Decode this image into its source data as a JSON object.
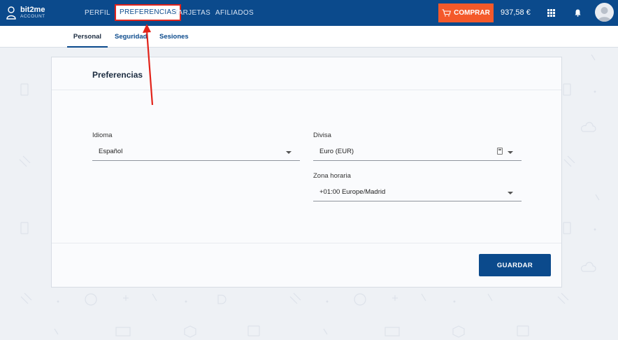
{
  "brand": {
    "name": "bit2me",
    "subtitle": "ACCOUNT"
  },
  "topnav": {
    "items": [
      {
        "label": "PERFIL"
      },
      {
        "label": "PREFERENCIAS"
      },
      {
        "label": "TARJETAS"
      },
      {
        "label": "AFILIADOS"
      }
    ],
    "buy_label": "COMPRAR",
    "balance": "937,58 €"
  },
  "subnav": {
    "tabs": [
      {
        "label": "Personal"
      },
      {
        "label": "Seguridad"
      },
      {
        "label": "Sesiones"
      }
    ]
  },
  "card": {
    "title": "Preferencias",
    "fields": {
      "language": {
        "label": "Idioma",
        "value": "Español"
      },
      "currency": {
        "label": "Divisa",
        "value": "Euro (EUR)"
      },
      "timezone": {
        "label": "Zona horaria",
        "value": "+01:00 Europe/Madrid"
      }
    },
    "save_label": "GUARDAR"
  },
  "colors": {
    "nav_bg": "#0b4a8c",
    "buy_btn": "#f4592a",
    "annotation": "#e2231a",
    "save_btn": "#0b4a8c"
  }
}
